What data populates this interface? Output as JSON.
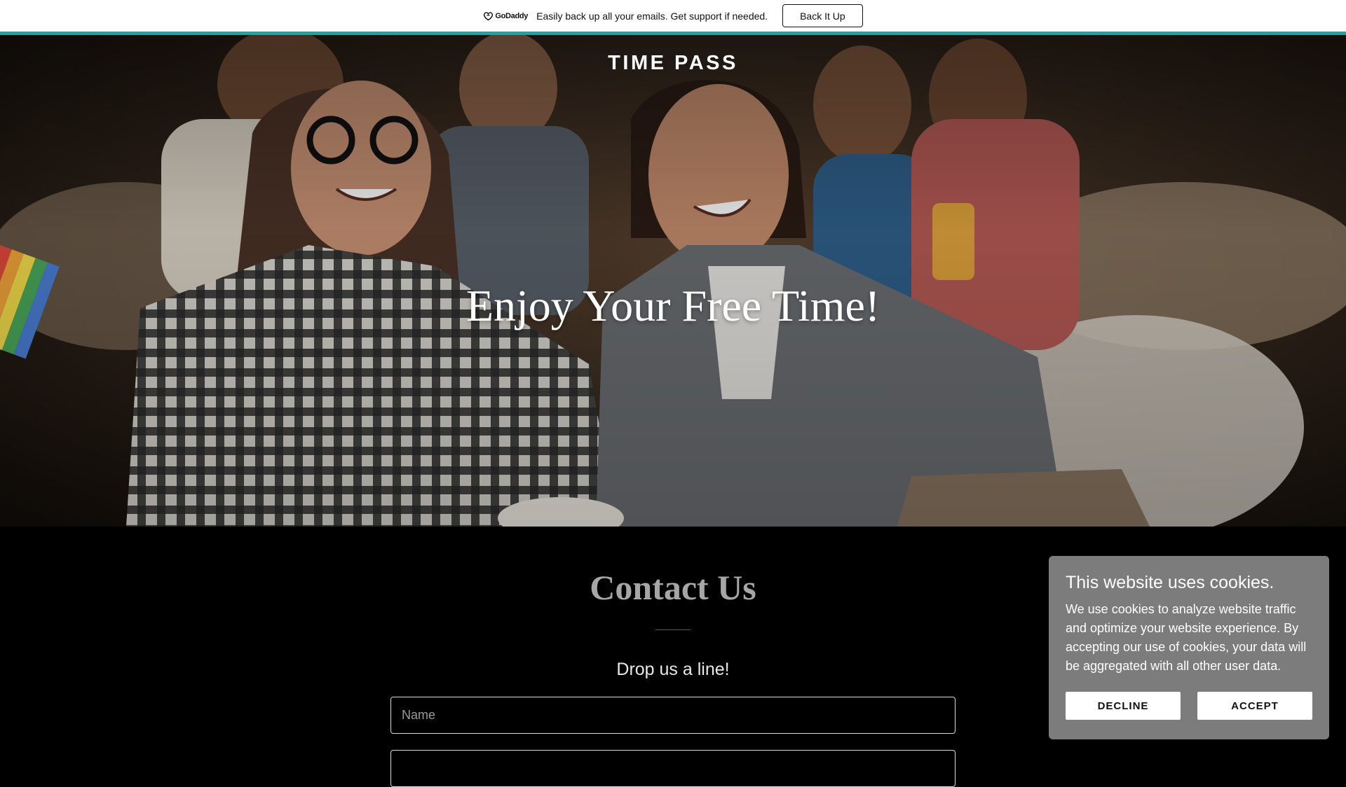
{
  "promo": {
    "logo_text": "GoDaddy",
    "message": "Easily back up all your emails. Get support if needed.",
    "button_label": "Back It Up",
    "accent_color": "#1ba7a6"
  },
  "hero": {
    "site_title": "TIME PASS",
    "heading": "Enjoy Your Free Time!"
  },
  "contact": {
    "title": "Contact Us",
    "subtitle": "Drop us a line!",
    "name_placeholder": "Name",
    "email_placeholder": ""
  },
  "cookie_banner": {
    "title": "This website uses cookies.",
    "text": "We use cookies to analyze website traffic and optimize your website experience. By accepting our use of cookies, your data will be aggregated with all other user data.",
    "decline_label": "DECLINE",
    "accept_label": "ACCEPT"
  }
}
